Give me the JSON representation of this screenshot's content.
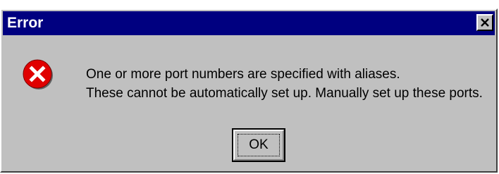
{
  "window": {
    "title": "Error",
    "close_icon": "close-icon"
  },
  "message": {
    "icon": "error-icon",
    "line1": "One or more port numbers are specified with aliases.",
    "line2": "These cannot be automatically set up.  Manually set up these ports."
  },
  "buttons": {
    "ok_label": "OK"
  },
  "colors": {
    "titlebar": "#000080",
    "dialog_bg": "#c0c0c0",
    "error_icon": "#e00000"
  }
}
